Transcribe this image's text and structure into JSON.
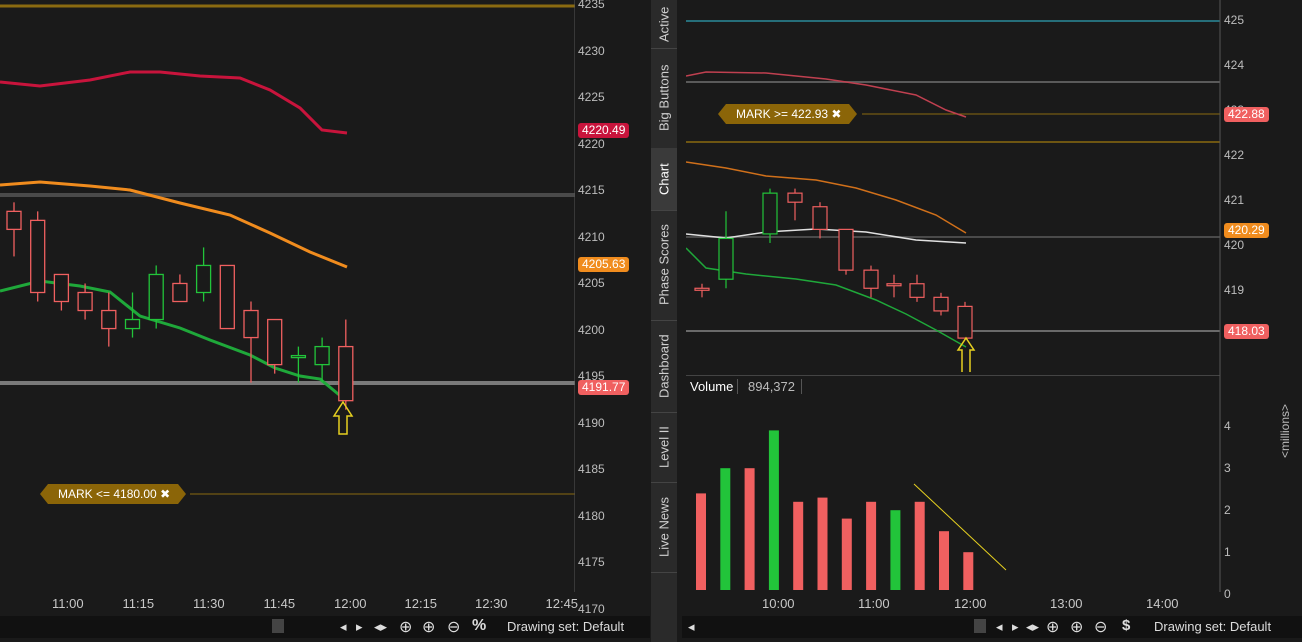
{
  "left": {
    "price_labels": [
      "4235",
      "4230",
      "4225",
      "4220",
      "4215",
      "4210",
      "4205",
      "4200",
      "4195",
      "4190",
      "4185",
      "4180",
      "4175",
      "4170"
    ],
    "time_labels": [
      "11:00",
      "11:15",
      "11:30",
      "11:45",
      "12:00",
      "12:15",
      "12:30",
      "12:45"
    ],
    "tags": {
      "upper_band": "4220.49",
      "middle_band": "4205.63",
      "last": "4191.77"
    },
    "alert": "MARK <= 4180.00 ✖",
    "toolbar": {
      "drawing_set": "Drawing set: Default",
      "pct": "%"
    }
  },
  "sidetabs": [
    "Active",
    "Big Buttons",
    "Chart",
    "Phase Scores",
    "Dashboard",
    "Level II",
    "Live News"
  ],
  "right": {
    "price_labels": [
      "425",
      "424",
      "423",
      "422",
      "421",
      "420",
      "419"
    ],
    "tags": {
      "alert_price": "422.88",
      "middle_band": "420.29",
      "last": "418.03"
    },
    "alert": "MARK >= 422.93 ✖",
    "volume": {
      "title": "Volume",
      "value": "894,372",
      "axis": [
        "4",
        "3",
        "2",
        "1",
        "0"
      ],
      "unit": "<millions>"
    },
    "time_labels": [
      "10:00",
      "11:00",
      "12:00",
      "13:00",
      "14:00"
    ],
    "toolbar": {
      "drawing_set": "Drawing set: Default",
      "dollar": "$"
    }
  },
  "colors": {
    "bg": "#1a1a1a",
    "up": "#22c43a",
    "down": "#f06060",
    "upper": "#c8143c",
    "mid": "#f08c1e",
    "lower": "#1fa83a",
    "alert": "#8b6508"
  },
  "chart_data": [
    {
      "type": "line",
      "ylim": [
        4170,
        4235
      ],
      "x": [
        "11:00",
        "11:15",
        "11:30",
        "11:45",
        "12:00",
        "12:15",
        "12:30",
        "12:45"
      ],
      "candles": [
        {
          "o": 4212,
          "h": 4213,
          "l": 4207,
          "c": 4210
        },
        {
          "o": 4211,
          "h": 4212,
          "l": 4202,
          "c": 4203
        },
        {
          "o": 4205,
          "h": 4205,
          "l": 4201,
          "c": 4202
        },
        {
          "o": 4203,
          "h": 4204,
          "l": 4200,
          "c": 4201
        },
        {
          "o": 4201,
          "h": 4203,
          "l": 4197,
          "c": 4199
        },
        {
          "o": 4199,
          "h": 4203,
          "l": 4198,
          "c": 4200
        },
        {
          "o": 4200,
          "h": 4206,
          "l": 4199,
          "c": 4205
        },
        {
          "o": 4204,
          "h": 4205,
          "l": 4202,
          "c": 4202
        },
        {
          "o": 4203,
          "h": 4208,
          "l": 4202,
          "c": 4206
        },
        {
          "o": 4206,
          "h": 4206,
          "l": 4199,
          "c": 4199
        },
        {
          "o": 4201,
          "h": 4202,
          "l": 4193,
          "c": 4198
        },
        {
          "o": 4200,
          "h": 4200,
          "l": 4194,
          "c": 4195
        },
        {
          "o": 4196,
          "h": 4197,
          "l": 4193,
          "c": 4196
        },
        {
          "o": 4195,
          "h": 4198,
          "l": 4193,
          "c": 4197
        },
        {
          "o": 4197,
          "h": 4200,
          "l": 4190,
          "c": 4191
        }
      ]
    },
    {
      "type": "bar",
      "ylim": [
        0,
        4
      ],
      "values": [
        2.3,
        2.9,
        2.9,
        3.8,
        2.1,
        2.2,
        1.7,
        2.1,
        1.9,
        2.1,
        1.4,
        0.9
      ],
      "up": [
        false,
        true,
        false,
        true,
        false,
        false,
        false,
        false,
        true,
        false,
        false,
        false
      ]
    }
  ]
}
